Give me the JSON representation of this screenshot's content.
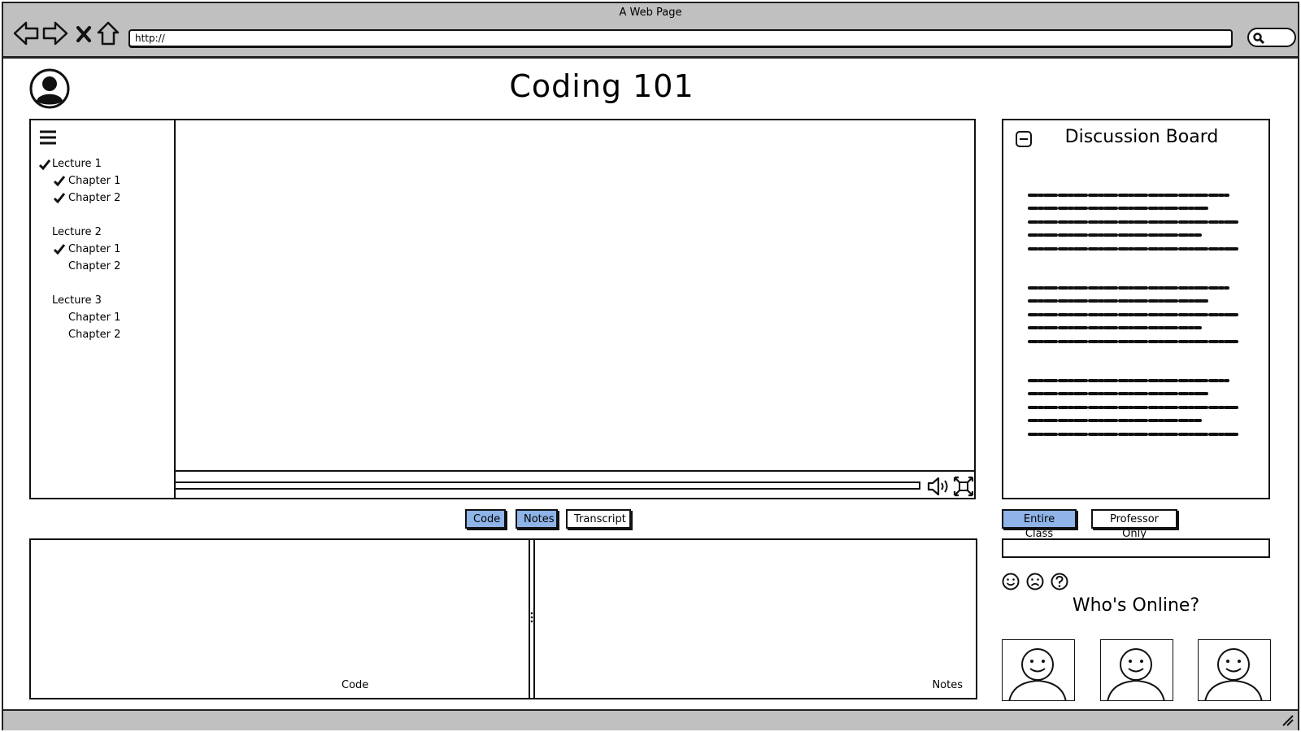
{
  "window": {
    "title": "A Web Page"
  },
  "browser": {
    "url": "http://"
  },
  "page": {
    "title": "Coding 101"
  },
  "sidebar": {
    "lectures": [
      {
        "label": "Lecture 1",
        "checked": true,
        "chapters": [
          {
            "label": "Chapter 1",
            "checked": true
          },
          {
            "label": "Chapter 2",
            "checked": true
          }
        ]
      },
      {
        "label": "Lecture 2",
        "checked": false,
        "chapters": [
          {
            "label": "Chapter 1",
            "checked": true
          },
          {
            "label": "Chapter 2",
            "checked": false
          }
        ]
      },
      {
        "label": "Lecture 3",
        "checked": false,
        "chapters": [
          {
            "label": "Chapter 1",
            "checked": false
          },
          {
            "label": "Chapter 2",
            "checked": false
          }
        ]
      }
    ]
  },
  "tabs": {
    "code": "Code",
    "notes": "Notes",
    "transcript": "Transcript"
  },
  "panes": {
    "code_label": "Code",
    "notes_label": "Notes"
  },
  "discussion": {
    "title": "Discussion Board",
    "audience": {
      "entire_class": "Entire Class",
      "professor_only": "Professor Only"
    },
    "whos_online": "Who's Online?"
  },
  "colors": {
    "active_tab": "#8eb4e8",
    "chrome": "#c0c0c0"
  },
  "icons": [
    "back-icon",
    "forward-icon",
    "stop-icon",
    "home-icon",
    "search-icon",
    "user-icon",
    "menu-icon",
    "check-icon",
    "volume-icon",
    "fullscreen-icon",
    "collapse-icon",
    "smile-icon",
    "frown-icon",
    "help-icon"
  ]
}
